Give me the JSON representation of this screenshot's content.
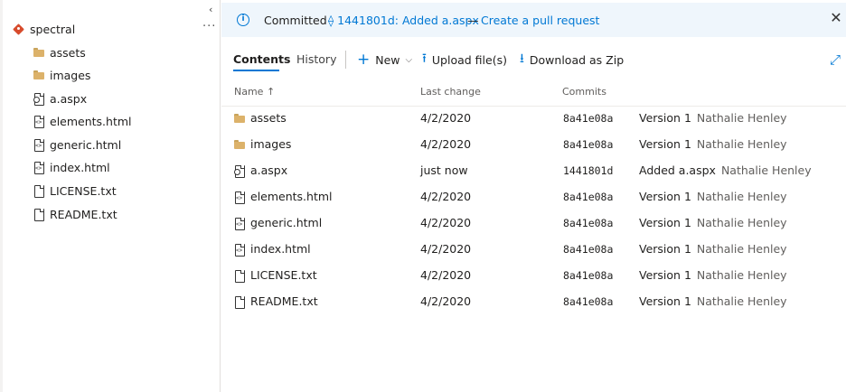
{
  "sidebar": {
    "collapse_glyph": "‹",
    "repo": {
      "name": "spectral",
      "icon": "repo-icon",
      "more_glyph": "···"
    },
    "items": [
      {
        "label": "assets",
        "icon": "folder-icon"
      },
      {
        "label": "images",
        "icon": "folder-icon"
      },
      {
        "label": "a.aspx",
        "icon": "aspx-file-icon"
      },
      {
        "label": "elements.html",
        "icon": "code-file-icon"
      },
      {
        "label": "generic.html",
        "icon": "code-file-icon"
      },
      {
        "label": "index.html",
        "icon": "code-file-icon"
      },
      {
        "label": "LICENSE.txt",
        "icon": "file-icon"
      },
      {
        "label": "README.txt",
        "icon": "file-icon"
      }
    ]
  },
  "banner": {
    "status": "Committed",
    "commit_link": "⟠ 1441801d: Added a.aspx",
    "separator": "—",
    "pr_link": "Create a pull request"
  },
  "toolbar": {
    "tabs": [
      {
        "label": "Contents",
        "active": true
      },
      {
        "label": "History",
        "active": false
      }
    ],
    "new_label": "New",
    "upload_label": "Upload file(s)",
    "download_label": "Download as Zip"
  },
  "table": {
    "columns": {
      "name": "Name ↑",
      "last_change": "Last change",
      "commits": "Commits"
    },
    "rows": [
      {
        "name": "assets",
        "icon": "folder-icon",
        "date": "4/2/2020",
        "commit": "8a41e08a",
        "message": "Version 1",
        "author": "Nathalie Henley"
      },
      {
        "name": "images",
        "icon": "folder-icon",
        "date": "4/2/2020",
        "commit": "8a41e08a",
        "message": "Version 1",
        "author": "Nathalie Henley"
      },
      {
        "name": "a.aspx",
        "icon": "aspx-file-icon",
        "date": "just now",
        "commit": "1441801d",
        "message": "Added a.aspx",
        "author": "Nathalie Henley"
      },
      {
        "name": "elements.html",
        "icon": "code-file-icon",
        "date": "4/2/2020",
        "commit": "8a41e08a",
        "message": "Version 1",
        "author": "Nathalie Henley"
      },
      {
        "name": "generic.html",
        "icon": "code-file-icon",
        "date": "4/2/2020",
        "commit": "8a41e08a",
        "message": "Version 1",
        "author": "Nathalie Henley"
      },
      {
        "name": "index.html",
        "icon": "code-file-icon",
        "date": "4/2/2020",
        "commit": "8a41e08a",
        "message": "Version 1",
        "author": "Nathalie Henley"
      },
      {
        "name": "LICENSE.txt",
        "icon": "file-icon",
        "date": "4/2/2020",
        "commit": "8a41e08a",
        "message": "Version 1",
        "author": "Nathalie Henley"
      },
      {
        "name": "README.txt",
        "icon": "file-icon",
        "date": "4/2/2020",
        "commit": "8a41e08a",
        "message": "Version 1",
        "author": "Nathalie Henley"
      }
    ]
  },
  "colors": {
    "accent": "#0078d4",
    "banner_bg": "#eff6fc",
    "folder": "#dcb26a",
    "repo": "#d74b2c"
  }
}
